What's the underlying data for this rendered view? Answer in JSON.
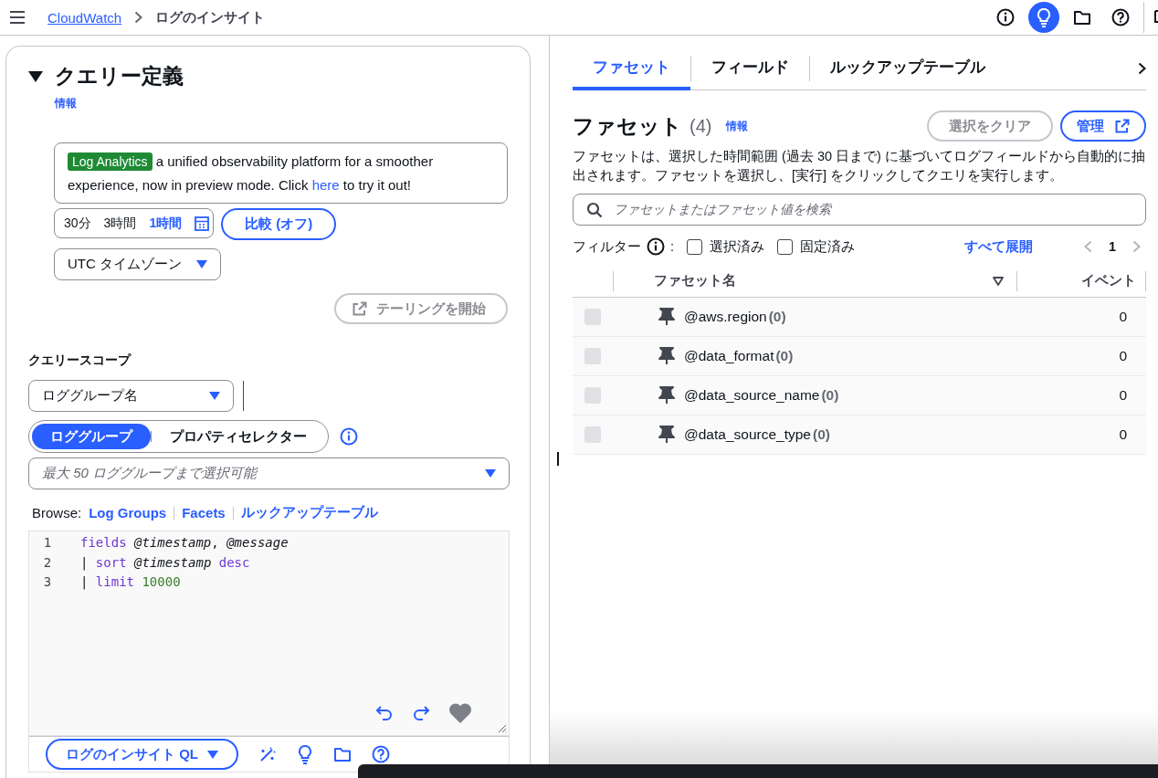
{
  "topbar": {
    "breadcrumbs": [
      {
        "label": "CloudWatch",
        "kind": "link"
      },
      {
        "label": "ログのインサイト",
        "kind": "current"
      }
    ],
    "tools": [
      {
        "kind": "info",
        "selected": false
      },
      {
        "kind": "bulb",
        "selected": true
      },
      {
        "kind": "folder",
        "selected": false
      },
      {
        "kind": "help",
        "selected": false
      },
      {
        "kind": "feedback",
        "selected": false
      }
    ]
  },
  "query": {
    "title": "クエリー定義",
    "expanded": true,
    "info": "情報",
    "banner": {
      "badge": "Log Analytics",
      "text": "a unified observability platform for a smoother experience, now in preview mode. Click ",
      "link": "here",
      "after": " to try it out!"
    },
    "ranges": [
      {
        "label": "30分",
        "selected": false
      },
      {
        "label": "3時間",
        "selected": false
      },
      {
        "label": "1時間",
        "selected": true
      }
    ],
    "compare": "比較 (オフ)",
    "timezone": "UTC タイムゾーン",
    "tail": {
      "label": "テーリングを開始",
      "disabled": true
    },
    "scope_label": "クエリースコープ",
    "scope_select": "ロググループ名",
    "scope_modes": [
      {
        "label": "ロググループ",
        "selected": true
      },
      {
        "label": "プロパティセレクター",
        "selected": false
      }
    ],
    "group_placeholder": "最大 50 ロググループまで選択可能",
    "browse": {
      "label": "Browse:",
      "links": [
        "Log Groups",
        "Facets",
        "ルックアップテーブル"
      ]
    },
    "editor": {
      "lines": [
        {
          "number": "1",
          "tokens": [
            {
              "text": "fields",
              "kind": "keyword"
            },
            {
              "text": " @timestamp",
              "kind": "field"
            },
            {
              "text": ",",
              "kind": "plain"
            },
            {
              "text": " @message",
              "kind": "field"
            }
          ]
        },
        {
          "number": "2",
          "tokens": [
            {
              "text": "|",
              "kind": "pipe"
            },
            {
              "text": " sort",
              "kind": "keyword"
            },
            {
              "text": " @timestamp",
              "kind": "field"
            },
            {
              "text": " desc",
              "kind": "keyword"
            }
          ]
        },
        {
          "number": "3",
          "tokens": [
            {
              "text": "|",
              "kind": "pipe"
            },
            {
              "text": " limit",
              "kind": "keyword"
            },
            {
              "text": " 10000",
              "kind": "number"
            }
          ]
        }
      ]
    },
    "language": "ログのインサイト QL"
  },
  "facets": {
    "tabs": [
      {
        "label": "ファセット",
        "selected": true
      },
      {
        "label": "フィールド",
        "selected": false
      },
      {
        "label": "ルックアップテーブル",
        "selected": false
      }
    ],
    "title": "ファセット",
    "count": "(4)",
    "info": "情報",
    "clear": {
      "label": "選択をクリア",
      "disabled": true
    },
    "manage": "管理",
    "description": "ファセットは、選択した時間範囲 (過去 30 日まで) に基づいてログフィールドから自動的に抽出されます。ファセットを選択し、[実行] をクリックしてクエリを実行します。",
    "search_placeholder": "ファセットまたはファセット値を検索",
    "filter": {
      "label": "フィルター",
      "separator": ":",
      "options": [
        {
          "label": "選択済み",
          "checked": false
        },
        {
          "label": "固定済み",
          "checked": false
        }
      ]
    },
    "expand_all": "すべて展開",
    "page": "1",
    "columns": [
      "ファセット名",
      "イベント"
    ],
    "rows": [
      {
        "name": "@aws.region",
        "count": "(0)",
        "events": "0",
        "disabled": true
      },
      {
        "name": "@data_format",
        "count": "(0)",
        "events": "0",
        "disabled": true
      },
      {
        "name": "@data_source_name",
        "count": "(0)",
        "events": "0",
        "disabled": true
      },
      {
        "name": "@data_source_type",
        "count": "(0)",
        "events": "0",
        "disabled": true
      }
    ]
  }
}
